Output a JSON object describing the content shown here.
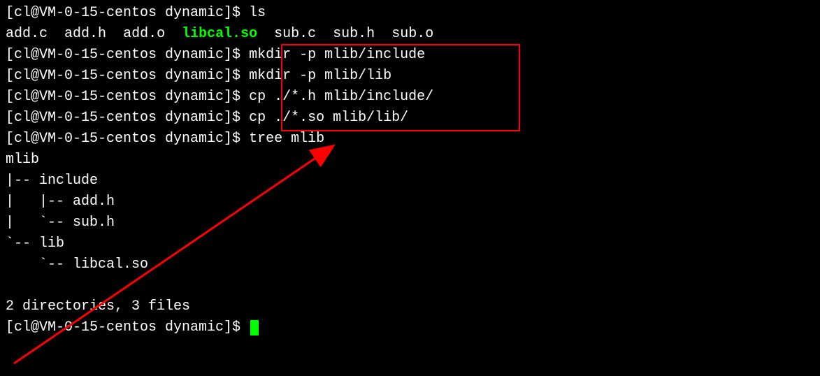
{
  "prompt": "[cl@VM-0-15-centos dynamic]$ ",
  "commands": {
    "ls": "ls",
    "mkdir1": "mkdir -p mlib/include",
    "mkdir2": "mkdir -p mlib/lib",
    "cp1": "cp ./*.h mlib/include/",
    "cp2": "cp ./*.so mlib/lib/",
    "tree": "tree mlib"
  },
  "ls_output": {
    "file1": "add.c",
    "file2": "add.h",
    "file3": "add.o",
    "file4": "libcal.so",
    "file5": "sub.c",
    "file6": "sub.h",
    "file7": "sub.o"
  },
  "tree_output": {
    "root": "mlib",
    "dir1": "|-- include",
    "file1": "|   |-- add.h",
    "file2": "|   `-- sub.h",
    "dir2": "`-- lib",
    "file3": "    `-- libcal.so",
    "summary": "2 directories, 3 files"
  }
}
